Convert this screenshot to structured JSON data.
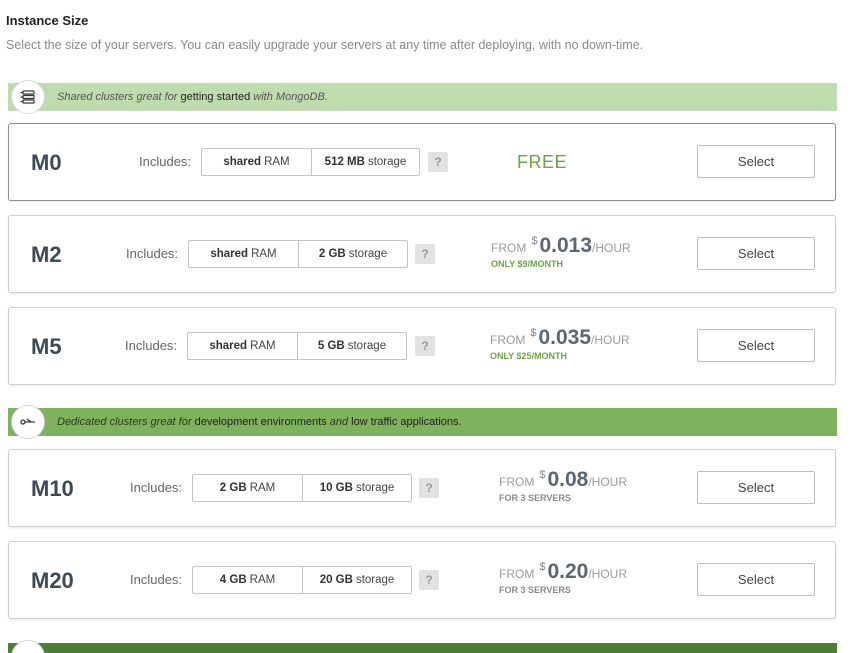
{
  "header": {
    "title": "Instance Size",
    "subtitle": "Select the size of your servers. You can easily upgrade your servers at any time after deploying, with no down-time."
  },
  "banners": [
    {
      "icon": "server-stack-icon",
      "pre": "Shared clusters great for ",
      "strong1": "getting started",
      "mid": " with MongoDB.",
      "strong2": "",
      "post": ""
    },
    {
      "icon": "scissors-icon",
      "pre": "Dedicated clusters great for ",
      "strong1": "development environments",
      "mid": " and ",
      "strong2": "low traffic applications",
      "post": "."
    }
  ],
  "tiers": [
    {
      "name": "M0",
      "includes": "Includes:",
      "ram_value": "shared",
      "ram_unit": "RAM",
      "storage_value": "512 MB",
      "storage_unit": "storage",
      "help": "?",
      "price_free": "FREE",
      "button": "Select"
    },
    {
      "name": "M2",
      "includes": "Includes:",
      "ram_value": "shared",
      "ram_unit": "RAM",
      "storage_value": "2 GB",
      "storage_unit": "storage",
      "help": "?",
      "price_from": "FROM",
      "price_currency": "$",
      "price_amount": "0.013",
      "price_per": "/HOUR",
      "price_note": "ONLY $9/MONTH",
      "button": "Select"
    },
    {
      "name": "M5",
      "includes": "Includes:",
      "ram_value": "shared",
      "ram_unit": "RAM",
      "storage_value": "5 GB",
      "storage_unit": "storage",
      "help": "?",
      "price_from": "FROM",
      "price_currency": "$",
      "price_amount": "0.035",
      "price_per": "/HOUR",
      "price_note": "ONLY $25/MONTH",
      "button": "Select"
    },
    {
      "name": "M10",
      "includes": "Includes:",
      "ram_value": "2 GB",
      "ram_unit": "RAM",
      "storage_value": "10 GB",
      "storage_unit": "storage",
      "help": "?",
      "price_from": "FROM",
      "price_currency": "$",
      "price_amount": "0.08",
      "price_per": "/HOUR",
      "price_note": "FOR 3 SERVERS",
      "button": "Select"
    },
    {
      "name": "M20",
      "includes": "Includes:",
      "ram_value": "4 GB",
      "ram_unit": "RAM",
      "storage_value": "20 GB",
      "storage_unit": "storage",
      "help": "?",
      "price_from": "FROM",
      "price_currency": "$",
      "price_amount": "0.20",
      "price_per": "/HOUR",
      "price_note": "FOR 3 SERVERS",
      "button": "Select"
    }
  ],
  "colors": {
    "banner_shared": "#bedcae",
    "banner_dedicated": "#7eb25d",
    "banner_next": "#4c7d34",
    "free_price": "#6ba443"
  }
}
